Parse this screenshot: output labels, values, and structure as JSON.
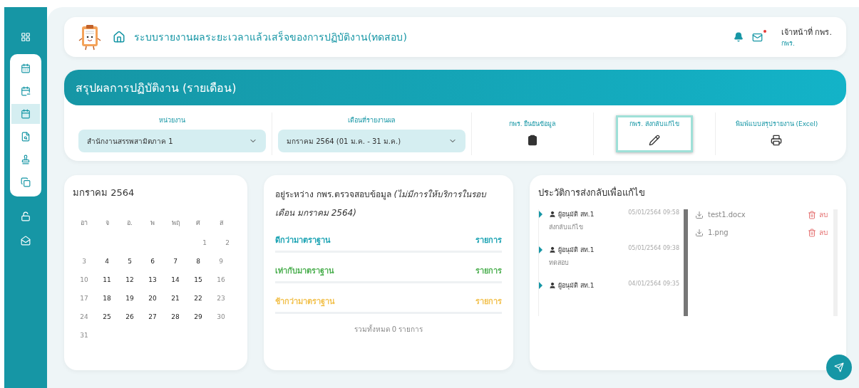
{
  "sidebar": {
    "items": [
      {
        "kind": "top",
        "selected": false
      },
      {
        "kind": "pill",
        "selected": false
      },
      {
        "kind": "pill",
        "selected": false
      },
      {
        "kind": "pill",
        "selected": true
      },
      {
        "kind": "pill",
        "selected": false
      },
      {
        "kind": "pill",
        "selected": false
      },
      {
        "kind": "pill",
        "selected": false
      },
      {
        "kind": "bottom",
        "selected": false
      },
      {
        "kind": "bottom",
        "selected": false
      }
    ]
  },
  "header": {
    "title": "ระบบรายงานผลระยะเวลาแล้วเสร็จของการปฏิบัติงาน(ทดสอบ)",
    "mail_unread": true,
    "user_name": "เจ้าหน้าที่ กพร.",
    "user_role": "กพร."
  },
  "banner": {
    "title": "สรุปผลการปฏิบัติงาน (รายเดือน)"
  },
  "filters": [
    {
      "label": "หน่วยงาน",
      "value": "สำนักงานสรรพสามิตภาค 1"
    },
    {
      "label": "เดือนที่รายงานผล",
      "value": "มกราคม 2564 (01 ม.ค. - 31 ม.ค.)"
    }
  ],
  "actions": [
    {
      "label": "กพร. ยืนยันข้อมูล",
      "selected": false
    },
    {
      "label": "กพร. ส่งกลับแก้ไข",
      "selected": true
    },
    {
      "label": "พิมพ์แบบสรุปรายงาน (Excel)",
      "selected": false
    }
  ],
  "calendar": {
    "title": "มกราคม 2564",
    "weekdays": [
      "อา",
      "จ",
      "อ.",
      "พ",
      "พฤ",
      "ศ",
      "ส"
    ],
    "weeks": [
      [
        {
          "day": "1",
          "dim": true
        },
        {
          "day": "2",
          "dim": true
        }
      ],
      [
        {
          "day": "3",
          "dim": true
        },
        {
          "day": "4",
          "dim": false
        },
        {
          "day": "5",
          "dim": false
        },
        {
          "day": "6",
          "dim": false
        },
        {
          "day": "7",
          "dim": false
        },
        {
          "day": "8",
          "dim": false
        },
        {
          "day": "9",
          "dim": true
        }
      ],
      [
        {
          "day": "10",
          "dim": true
        },
        {
          "day": "11",
          "dim": false
        },
        {
          "day": "12",
          "dim": false
        },
        {
          "day": "13",
          "dim": false
        },
        {
          "day": "14",
          "dim": false
        },
        {
          "day": "15",
          "dim": false
        },
        {
          "day": "16",
          "dim": true
        }
      ],
      [
        {
          "day": "17",
          "dim": true
        },
        {
          "day": "18",
          "dim": false
        },
        {
          "day": "19",
          "dim": false
        },
        {
          "day": "20",
          "dim": false
        },
        {
          "day": "21",
          "dim": false
        },
        {
          "day": "22",
          "dim": false
        },
        {
          "day": "23",
          "dim": true
        }
      ],
      [
        {
          "day": "24",
          "dim": true
        },
        {
          "day": "25",
          "dim": false
        },
        {
          "day": "26",
          "dim": false
        },
        {
          "day": "27",
          "dim": false
        },
        {
          "day": "28",
          "dim": false
        },
        {
          "day": "29",
          "dim": false
        },
        {
          "day": "30",
          "dim": true
        }
      ],
      [
        {
          "day": "31",
          "dim": true
        }
      ]
    ]
  },
  "review": {
    "title": "อยู่ระหว่าง กพร.ตรวจสอบข้อมูล *(ไม่มีการให้บริการในรอบเดือน มกราคม 2564)*",
    "rows": [
      {
        "label": "ดีกว่ามาตราฐาน",
        "unit": "รายการ",
        "color": "#1ba3b3"
      },
      {
        "label": "เท่ากับมาตราฐาน",
        "unit": "รายการ",
        "color": "#4caf50"
      },
      {
        "label": "ช้ากว่ามาตราฐาน",
        "unit": "รายการ",
        "color": "#f2c14e"
      }
    ],
    "total": "รวมทั้งหมด 0 รายการ"
  },
  "history": {
    "title": "ประวัติการส่งกลับเพื่อแก้ไข",
    "entries": [
      {
        "user": "ผู้อนุมัติ สท.1",
        "date": "05/01/2564 09:58",
        "note": "ส่งกลับแก้ไข"
      },
      {
        "user": "ผู้อนุมัติ สท.1",
        "date": "05/01/2564 09:38",
        "note": "ทดสอบ"
      },
      {
        "user": "ผู้อนุมัติ สท.1",
        "date": "04/01/2564 09:35"
      }
    ],
    "files": [
      {
        "name": "test1.docx",
        "delete": "ลบ"
      },
      {
        "name": "1.png",
        "delete": "ลบ"
      }
    ]
  }
}
